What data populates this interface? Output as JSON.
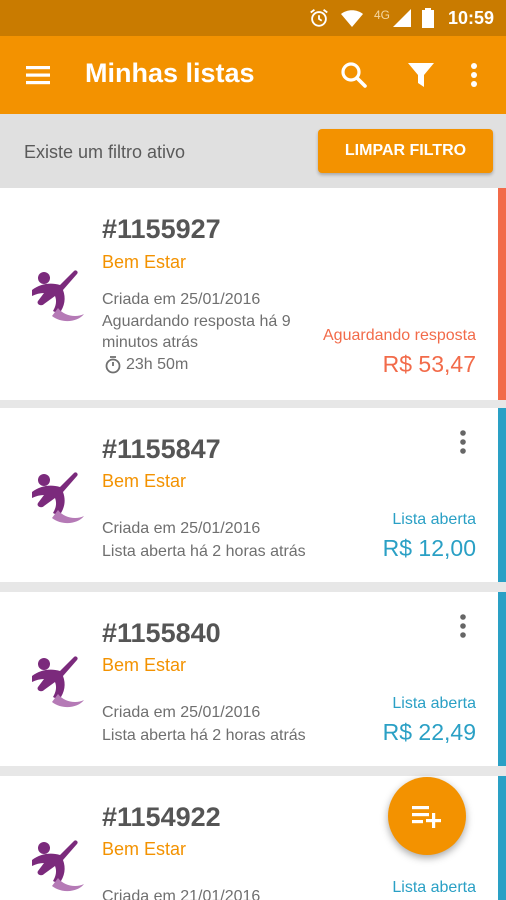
{
  "status_bar": {
    "time": "10:59",
    "network": "4G"
  },
  "app_bar": {
    "title": "Minhas listas"
  },
  "filter_bar": {
    "message": "Existe um filtro ativo",
    "clear_button": "LIMPAR FILTRO"
  },
  "colors": {
    "brand": "#f39200",
    "awaiting": "#f26b4a",
    "open": "#2aa0c5",
    "logo": "#7b2a7c"
  },
  "lists": [
    {
      "number": "#1155927",
      "category": "Bem Estar",
      "created": "Criada em 25/01/2016",
      "detail_line1": "Aguardando resposta há 9",
      "detail_line2": "minutos atrás",
      "timer": "23h 50m",
      "status": "Aguardando resposta",
      "price": "R$ 53,47"
    },
    {
      "number": "#1155847",
      "category": "Bem Estar",
      "created": "Criada em 25/01/2016",
      "detail_line1": "Lista aberta há 2 horas atrás",
      "status": "Lista aberta",
      "price": "R$ 12,00"
    },
    {
      "number": "#1155840",
      "category": "Bem Estar",
      "created": "Criada em 25/01/2016",
      "detail_line1": "Lista aberta há 2 horas atrás",
      "status": "Lista aberta",
      "price": "R$ 22,49"
    },
    {
      "number": "#1154922",
      "category": "Bem Estar",
      "created": "Criada em 21/01/2016",
      "status": "Lista aberta"
    }
  ],
  "icons": [
    "alarm-icon",
    "wifi-icon",
    "signal-icon",
    "battery-icon",
    "menu-icon",
    "search-icon",
    "filter-icon",
    "more-vert-icon",
    "timer-icon",
    "kebab-icon",
    "playlist-add-icon",
    "wellness-logo"
  ]
}
